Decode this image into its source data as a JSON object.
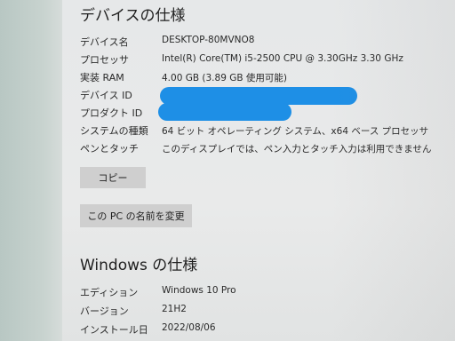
{
  "device_spec": {
    "title": "デバイスの仕様",
    "rows": [
      {
        "label": "デバイス名",
        "value": "DESKTOP-80MVNO8"
      },
      {
        "label": "プロセッサ",
        "value": "Intel(R) Core(TM) i5-2500 CPU @ 3.30GHz   3.30 GHz"
      },
      {
        "label": "実装 RAM",
        "value": "4.00 GB (3.89 GB 使用可能)"
      },
      {
        "label": "デバイス ID",
        "value": ""
      },
      {
        "label": "プロダクト ID",
        "value": ""
      },
      {
        "label": "システムの種類",
        "value": "64 ビット オペレーティング システム、x64 ベース プロセッサ"
      },
      {
        "label": "ペンとタッチ",
        "value": "このディスプレイでは、ペン入力とタッチ入力は利用できません"
      }
    ],
    "copy_button": "コピー",
    "rename_button": "この PC の名前を変更"
  },
  "windows_spec": {
    "title": "Windows の仕様",
    "rows": [
      {
        "label": "エディション",
        "value": "Windows 10 Pro"
      },
      {
        "label": "バージョン",
        "value": "21H2"
      },
      {
        "label": "インストール日",
        "value": "2022/08/06"
      }
    ]
  },
  "colors": {
    "redaction": "#1e8fe6"
  }
}
